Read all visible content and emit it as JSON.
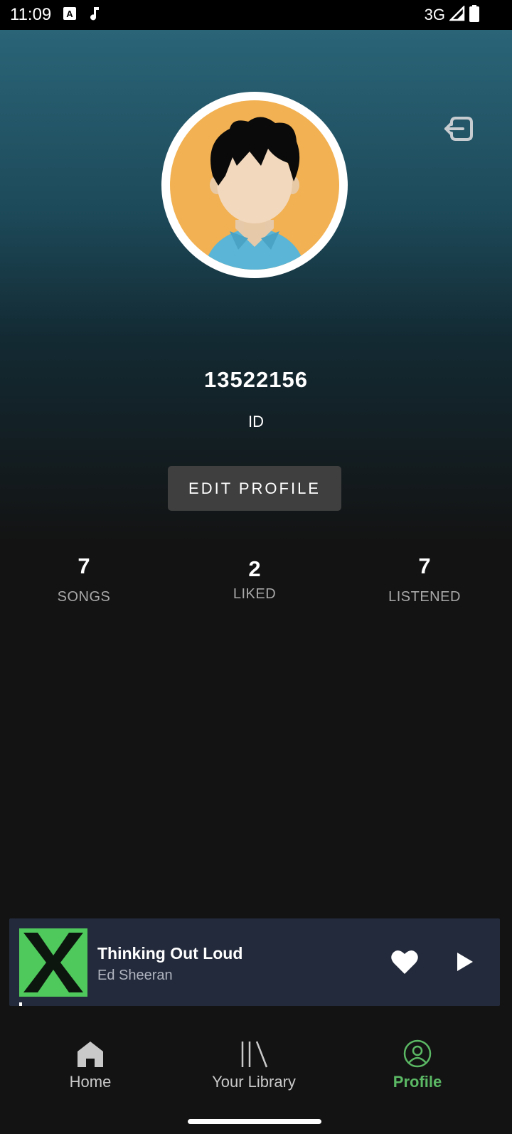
{
  "status_bar": {
    "time": "11:09",
    "network": "3G"
  },
  "profile": {
    "username": "13522156",
    "id_label": "ID",
    "edit_button": "EDIT PROFILE"
  },
  "stats": [
    {
      "value": "7",
      "label": "SONGS"
    },
    {
      "value": "2",
      "label": "LIKED"
    },
    {
      "value": "7",
      "label": "LISTENED"
    }
  ],
  "now_playing": {
    "title": "Thinking Out Loud",
    "artist": "Ed Sheeran",
    "liked": true,
    "album_color": "#4fc95c",
    "progress_fraction": 0.006
  },
  "nav": {
    "items": [
      {
        "label": "Home",
        "icon": "home-icon",
        "active": false
      },
      {
        "label": "Your Library",
        "icon": "library-icon",
        "active": false
      },
      {
        "label": "Profile",
        "icon": "profile-icon",
        "active": true
      }
    ]
  },
  "colors": {
    "accent": "#5bb864",
    "background": "#131313",
    "player_bg": "#232a3b",
    "gradient_top": "#2a6477"
  }
}
